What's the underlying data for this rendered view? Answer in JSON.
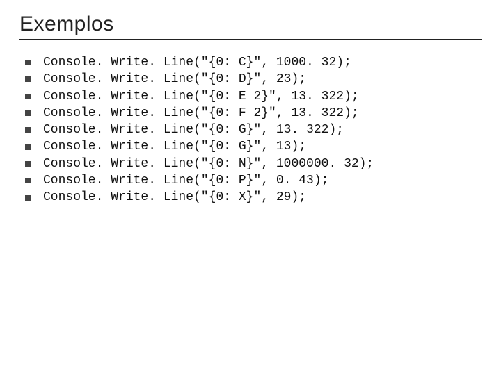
{
  "title": "Exemplos",
  "lines": [
    "Console. Write. Line(\"{0: C}\", 1000. 32);",
    "Console. Write. Line(\"{0: D}\", 23);",
    "Console. Write. Line(\"{0: E 2}\", 13. 322);",
    "Console. Write. Line(\"{0: F 2}\", 13. 322);",
    "Console. Write. Line(\"{0: G}\", 13. 322);",
    "Console. Write. Line(\"{0: G}\", 13);",
    "Console. Write. Line(\"{0: N}\", 1000000. 32);",
    "Console. Write. Line(\"{0: P}\", 0. 43);",
    "Console. Write. Line(\"{0: X}\", 29);"
  ]
}
